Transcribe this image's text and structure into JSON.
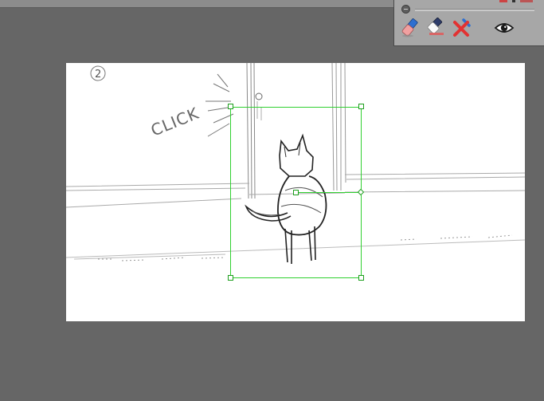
{
  "tool_panel": {
    "tools": [
      {
        "name": "pencil-eraser-tool",
        "icon": "pencil-eraser-icon"
      },
      {
        "name": "eraser-tool",
        "icon": "eraser-icon"
      },
      {
        "name": "clear-tool",
        "icon": "red-x-icon"
      },
      {
        "name": "visibility-toggle",
        "icon": "eye-icon"
      }
    ],
    "colors": {
      "panel_bg": "#a7a7a7",
      "accent_red": "#e23232",
      "accent_blue": "#2e6fd0"
    }
  },
  "canvas": {
    "sketch_text": {
      "panel_number": "2",
      "sound_effect": "CLICK"
    },
    "selection": {
      "color": "#2fd02f",
      "pivot": "diamond"
    }
  }
}
